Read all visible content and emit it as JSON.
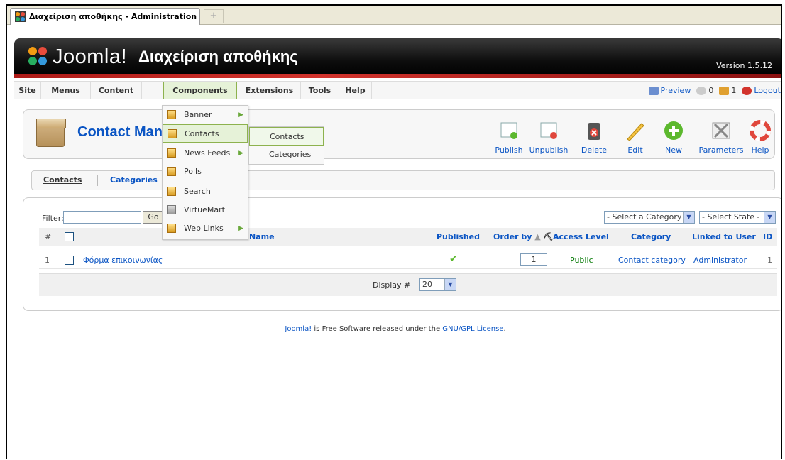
{
  "browser": {
    "tab_title": "Διαχείριση αποθήκης - Administration",
    "new_tab_glyph": "+"
  },
  "header": {
    "logo_text": "Joomla!",
    "site_name": "Διαχείριση αποθήκης",
    "version": "Version 1.5.12"
  },
  "menubar": {
    "items": [
      "Site",
      "Menus",
      "Content",
      "Components",
      "Extensions",
      "Tools",
      "Help"
    ],
    "active": "Components",
    "preview": "Preview",
    "messages_count": "0",
    "users_count": "1",
    "logout": "Logout"
  },
  "toolbar": {
    "title": "Contact Manager",
    "buttons": [
      "Publish",
      "Unpublish",
      "Delete",
      "Edit",
      "New",
      "Parameters",
      "Help"
    ]
  },
  "subtabs": {
    "current": "Contacts",
    "other": "Categories"
  },
  "filter": {
    "label": "Filter:",
    "value": "",
    "go": "Go",
    "category_select": "- Select a Category -",
    "state_select": "- Select State -"
  },
  "table": {
    "headers": {
      "num": "#",
      "name": "Name",
      "published": "Published",
      "order_by": "Order by",
      "access": "Access Level",
      "category": "Category",
      "linked_user": "Linked to User",
      "id": "ID"
    },
    "rows": [
      {
        "num": "1",
        "name": "Φόρμα επικοινωνίας",
        "published": "✔",
        "order": "1",
        "access": "Public",
        "category": "Contact category",
        "linked_user": "Administrator",
        "id": "1"
      }
    ],
    "display_label": "Display #",
    "display_value": "20"
  },
  "components_menu": {
    "items": [
      "Banner",
      "Contacts",
      "News Feeds",
      "Polls",
      "Search",
      "VirtueMart",
      "Web Links"
    ],
    "active": "Contacts",
    "submenu": [
      "Contacts",
      "Categories"
    ]
  },
  "footer": {
    "joomla": "Joomla!",
    "middle": " is Free Software released under the ",
    "license": "GNU/GPL License",
    "end": "."
  },
  "colors": {
    "link": "#0b55c4",
    "header_bg": "#000000",
    "accent_red": "#d2332c",
    "active_green": "#8db24e"
  }
}
